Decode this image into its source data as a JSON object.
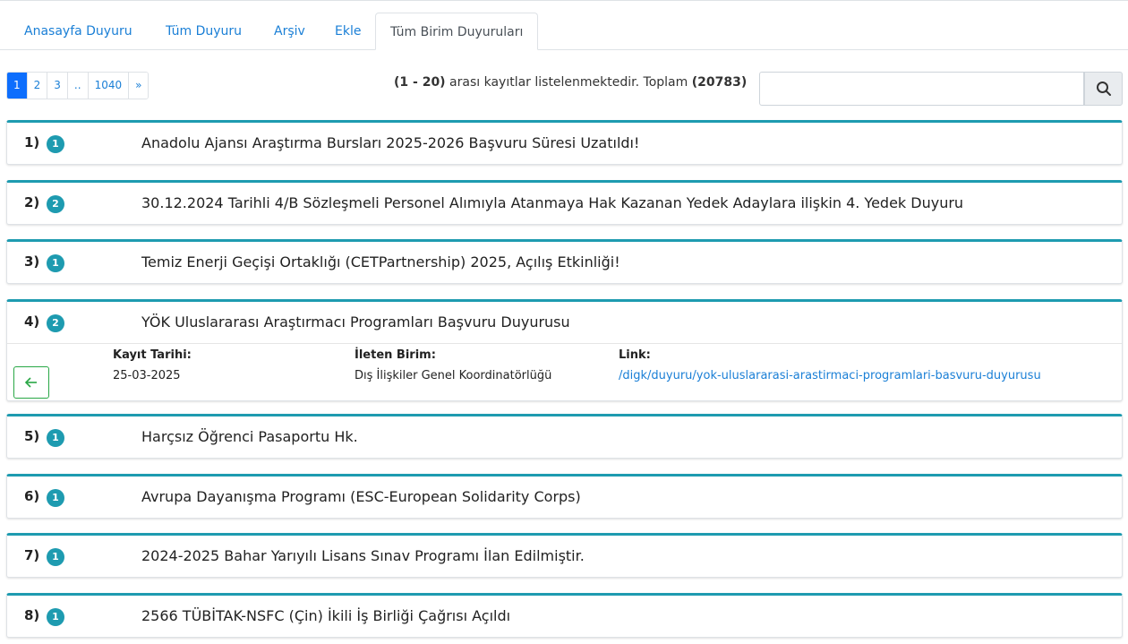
{
  "tabs": [
    {
      "label": "Anasayfa Duyuru"
    },
    {
      "label": "Tüm Duyuru"
    },
    {
      "label": "Arşiv"
    },
    {
      "label": "Ekle"
    },
    {
      "label": "Tüm Birim Duyuruları",
      "active": true
    }
  ],
  "pagination": {
    "pages": [
      "1",
      "2",
      "3",
      "..",
      "1040",
      "»"
    ],
    "current": "1"
  },
  "summary": {
    "range": "(1 - 20)",
    "text": " arası kayıtlar listelenmektedir. Toplam ",
    "total": "(20783)"
  },
  "search": {
    "value": "",
    "placeholder": ""
  },
  "icons": {
    "search": "search-icon",
    "back": "arrow-left-icon"
  },
  "colors": {
    "accent": "#1e9bb0",
    "link": "#1a7fd6",
    "active_page": "#0d6efd",
    "back_button": "#28a745"
  },
  "announcements": [
    {
      "num": "1)",
      "badge": "1",
      "title": "Anadolu Ajansı Araştırma Bursları 2025-2026 Başvuru Süresi Uzatıldı!"
    },
    {
      "num": "2)",
      "badge": "2",
      "title": "30.12.2024 Tarihli 4/B Sözleşmeli Personel Alımıyla Atanmaya Hak Kazanan Yedek Adaylara ilişkin 4. Yedek Duyuru"
    },
    {
      "num": "3)",
      "badge": "1",
      "title": "Temiz Enerji Geçişi Ortaklığı (CETPartnership) 2025, Açılış Etkinliği!"
    },
    {
      "num": "4)",
      "badge": "2",
      "title": "YÖK Uluslararası Araştırmacı Programları Başvuru Duyurusu",
      "detail": {
        "date_label": "Kayıt Tarihi:",
        "date": "25-03-2025",
        "unit_label": "İleten Birim:",
        "unit": "Dış İlişkiler Genel Koordinatörlüğü",
        "link_label": "Link:",
        "link": "/digk/duyuru/yok-uluslararasi-arastirmaci-programlari-basvuru-duyurusu"
      }
    },
    {
      "num": "5)",
      "badge": "1",
      "title": "Harçsız Öğrenci Pasaportu Hk."
    },
    {
      "num": "6)",
      "badge": "1",
      "title": "Avrupa Dayanışma Programı (ESC-European Solidarity Corps)"
    },
    {
      "num": "7)",
      "badge": "1",
      "title": "2024-2025 Bahar Yarıyılı Lisans Sınav Programı İlan Edilmiştir."
    },
    {
      "num": "8)",
      "badge": "1",
      "title": "2566 TÜBİTAK-NSFC (Çin) İkili İş Birliği Çağrısı Açıldı"
    }
  ]
}
